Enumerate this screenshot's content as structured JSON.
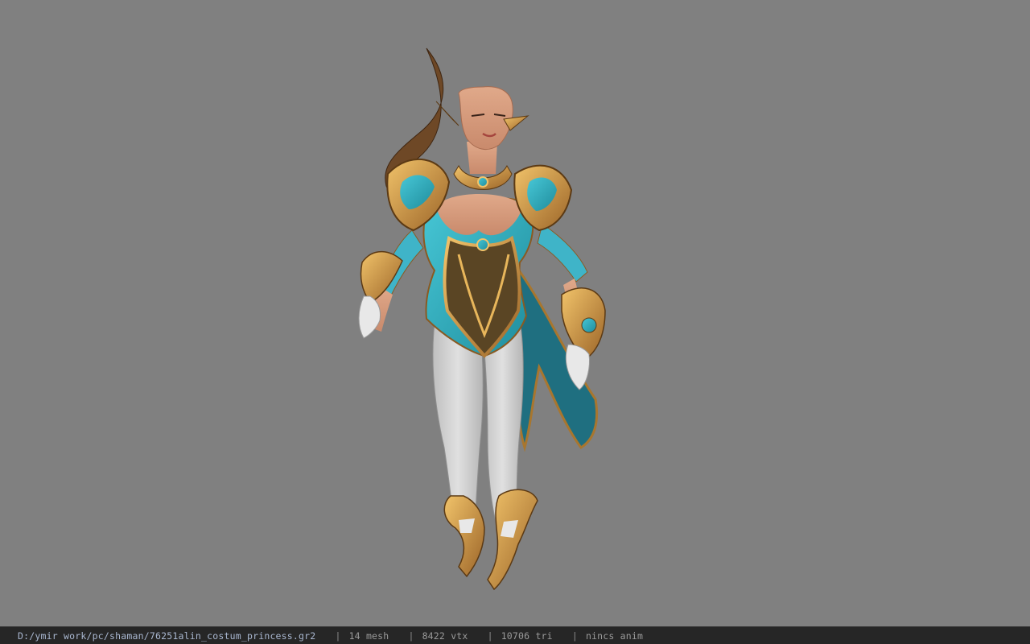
{
  "viewer": {
    "background_color": "#808080",
    "model_label": "character-model"
  },
  "statusbar": {
    "file_path": "D:/ymir work/pc/shaman/76251alin_costum_princess.gr2",
    "separator": "|",
    "mesh_count": "14",
    "mesh_unit": "mesh",
    "vertex_count": "8422",
    "vertex_unit": "vtx",
    "triangle_count": "10706",
    "triangle_unit": "tri",
    "anim_status": "nincs anim",
    "colors": {
      "background": "#262626",
      "path_text": "#a9b7d0",
      "stat_text": "#9a9a9a"
    }
  }
}
